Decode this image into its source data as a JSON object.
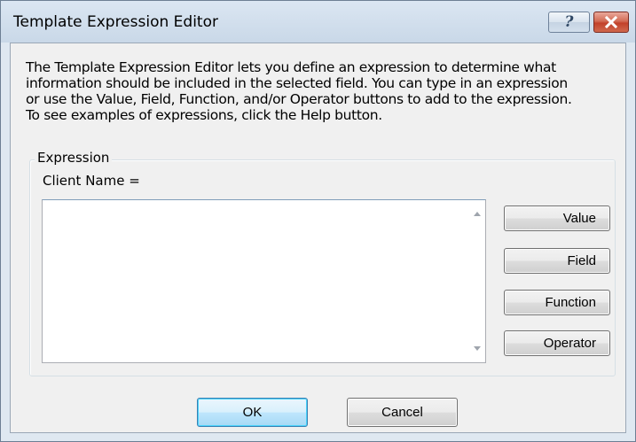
{
  "window": {
    "title": "Template Expression Editor",
    "help_glyph": "?",
    "close_icon": "close-icon",
    "help_icon": "help-icon"
  },
  "description": {
    "lines": [
      "The Template Expression Editor lets you define an expression to determine what",
      "information should be included in the selected field.  You can type in an expression",
      "or use the Value, Field, Function, and/or Operator buttons to add to the expression.",
      "To see examples of expressions, click the Help button."
    ]
  },
  "expression": {
    "group_label": "Expression",
    "field_label": "Client Name =",
    "value": ""
  },
  "buttons": {
    "value": "Value",
    "field": "Field",
    "function": "Function",
    "operator": "Operator",
    "ok": "OK",
    "cancel": "Cancel"
  },
  "colors": {
    "titlebar": "#c9d8e8",
    "dialog_background": "#f0f0f0",
    "close_button": "#c2412a",
    "default_button_border": "#3c7fb1"
  }
}
